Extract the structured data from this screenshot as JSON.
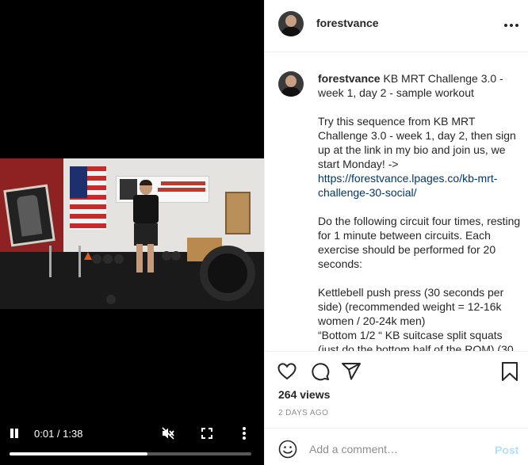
{
  "video": {
    "current_time": "0:01",
    "duration": "1:38",
    "time_display": "0:01 / 1:38",
    "progress": 0.57,
    "icons": [
      "pause-icon",
      "mute-icon",
      "fullscreen-icon",
      "more-vertical-icon"
    ]
  },
  "header": {
    "username": "forestvance",
    "more_icon": "more-horizontal-icon"
  },
  "caption": {
    "username": "forestvance",
    "title": " KB MRT Challenge 3.0 - week 1, day 2 - sample workout",
    "paragraph1": "Try this sequence from KB MRT Challenge 3.0 - week 1, day 2, then sign up at the link in my bio and join us, we start Monday! ->",
    "link": "https://forestvance.lpages.co/kb-mrt-challenge-30-social/",
    "paragraph2": "Do the following circuit four times, resting for 1 minute between circuits. Each exercise should be performed for 20 seconds:",
    "paragraph3": "Kettlebell push press (30 seconds per side) (recommended weight = 12-16k women / 20-24k men)",
    "paragraph4": "“Bottom 1/2 “ KB suitcase split squats (just do the bottom half of the ROM) (30"
  },
  "actions": {
    "icons": [
      "heart-icon",
      "comment-icon",
      "share-icon",
      "bookmark-icon"
    ],
    "views": "264 views",
    "date": "2 DAYS AGO"
  },
  "comment_bar": {
    "placeholder": "Add a comment…",
    "post_label": "Post",
    "post_color": "#b2dffc",
    "emoji_icon": "emoji-icon"
  },
  "colors": {
    "link": "#00376b",
    "muted": "#8e8e8e",
    "text": "#262626"
  }
}
